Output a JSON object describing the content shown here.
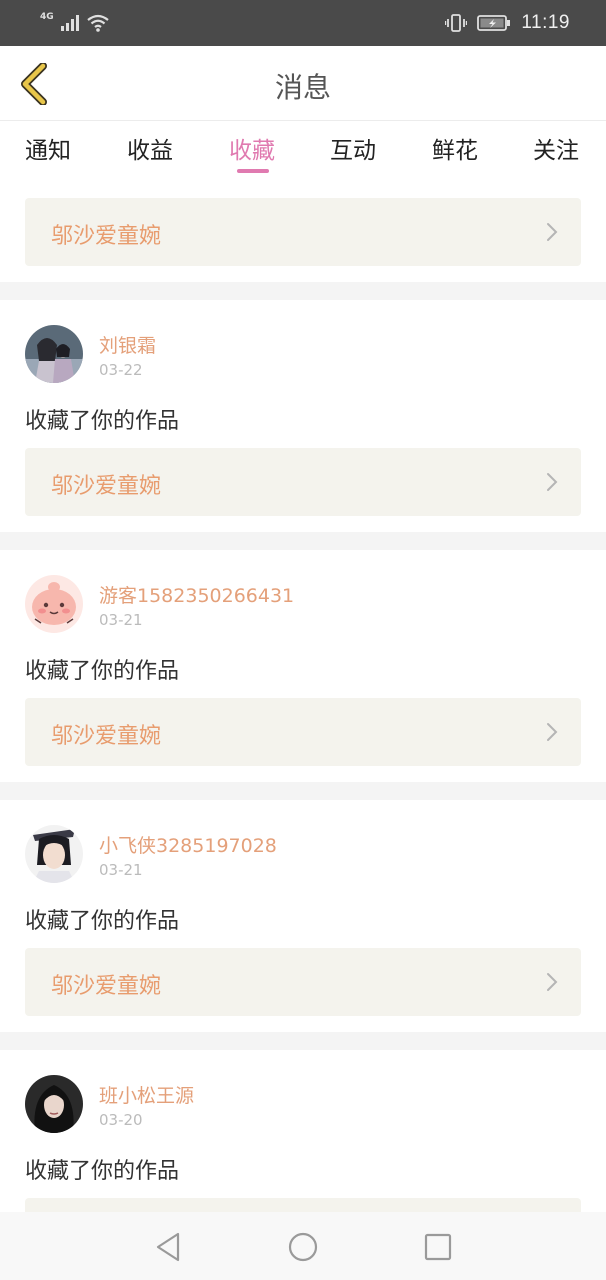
{
  "status_bar": {
    "network": "4G",
    "time": "11:19",
    "icons": [
      "signal-icon",
      "wifi-icon",
      "vibrate-icon",
      "battery-charging-icon"
    ]
  },
  "header": {
    "title": "消息",
    "back_icon": "chevron-left-icon",
    "accent_color": "#e8c64a"
  },
  "tabs": [
    {
      "label": "通知",
      "active": false
    },
    {
      "label": "收益",
      "active": false
    },
    {
      "label": "收藏",
      "active": true
    },
    {
      "label": "互动",
      "active": false
    },
    {
      "label": "鲜花",
      "active": false
    },
    {
      "label": "关注",
      "active": false
    }
  ],
  "colors": {
    "active_tab": "#e07ab0",
    "username": "#e4a07a",
    "work_title": "#e89c6e",
    "work_bg": "#f4f3ed"
  },
  "top_item": {
    "work_title": "邬沙爱童婉"
  },
  "messages": [
    {
      "username": "刘银霜",
      "date": "03-22",
      "action": "收藏了你的作品",
      "work_title": "邬沙爱童婉",
      "avatar": "photo-avatar"
    },
    {
      "username": "游客1582350266431",
      "date": "03-21",
      "action": "收藏了你的作品",
      "work_title": "邬沙爱童婉",
      "avatar": "cartoon-avatar"
    },
    {
      "username": "小飞侠3285197028",
      "date": "03-21",
      "action": "收藏了你的作品",
      "work_title": "邬沙爱童婉",
      "avatar": "photo-avatar"
    },
    {
      "username": "班小松王源",
      "date": "03-20",
      "action": "收藏了你的作品",
      "avatar": "photo-avatar"
    }
  ],
  "nav_bar": {
    "buttons": [
      "back-triangle-icon",
      "home-circle-icon",
      "recents-square-icon"
    ]
  }
}
